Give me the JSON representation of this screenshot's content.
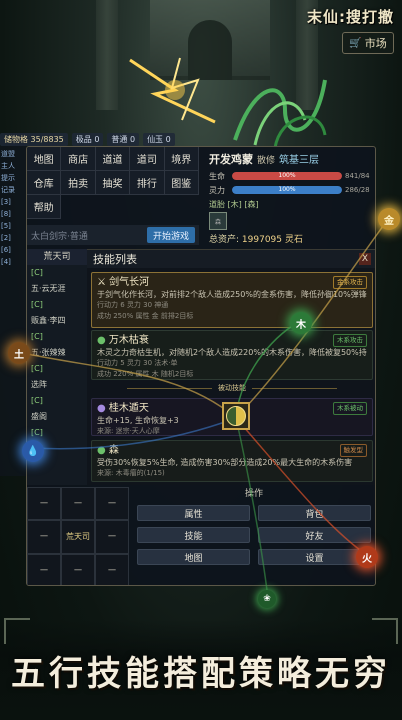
{
  "header": {
    "game_title": "末仙:搜打撤",
    "market_label": "市场",
    "market_icon": "cart-icon"
  },
  "resources": [
    "储物格 35/8835",
    "极品 0",
    "普通 0",
    "仙玉 0"
  ],
  "left_strip": [
    "道盟",
    "主人",
    "提示",
    "记录",
    "[3]",
    "[8]",
    "[5]",
    "[2]",
    "[6]",
    "[4]"
  ],
  "nav": {
    "items": [
      "地图",
      "商店",
      "道道",
      "道司",
      "境界",
      "仓库",
      "拍卖",
      "抽奖",
      "排行",
      "图鉴",
      "帮助"
    ]
  },
  "channel": {
    "placeholder": "太白剑宗·普通",
    "button": "开始游戏"
  },
  "player": {
    "name": "开发鸡蒙",
    "status": "散修",
    "realm": "筑基三层",
    "hp_label": "生命",
    "hp_pct": "100%",
    "hp_val": "841/84",
    "mp_label": "灵力",
    "mp_pct": "100%",
    "mp_val": "286/28",
    "daohao": "道胎 [木] [森]",
    "avatar_label": "森",
    "assets_label": "总资产:",
    "assets_value": "1997095 灵石"
  },
  "sect_list": {
    "header": "荒天司",
    "items": [
      "[C]",
      "五·云无涯",
      "[C]",
      "贩鑫·李四",
      "[C]",
      "五·张辣辣",
      "[C]",
      "选阵",
      "[C]",
      "盛阁",
      "[C]",
      "[C]"
    ]
  },
  "skill_panel": {
    "title": "技能列表",
    "close": "X",
    "passive_divider": "被动技能",
    "skills": [
      {
        "name": "剑气长河",
        "tag": "金系攻击",
        "desc": "于剑气化作长河，对前排2个敌人造成250%的金系伤害，降低孙御10%弹锋6秒",
        "meta": "行动力 6 灵力 30 神通",
        "meta2": "成功 250% 属性 金 前排2目标"
      },
      {
        "name": "万木枯衰",
        "tag": "木系攻击",
        "desc": "木灵之力奇枯生机，对随机2个敌人造成220%的木系伤害，降低被复50%持续10秒",
        "meta": "行动力 5 灵力 30 法术·单",
        "meta2": "成功 220% 属性 木 随机2目标"
      },
      {
        "name": "桂木遁天",
        "tag": "木系被动",
        "desc": "生命+15, 生命恢复+3",
        "meta": "来源: 迷宗·天人心摩"
      },
      {
        "name": "森",
        "tag": "触发型",
        "desc": "受伤30%恢复5%生命, 造成伤害30%部分造成20%最大生命的木系伤害",
        "meta": "来源: 木毒瘤的(1/15)"
      }
    ]
  },
  "bottom_grid": [
    "一",
    "一",
    "一",
    "一",
    "荒天司",
    "一",
    "一",
    "一",
    "一"
  ],
  "operations": {
    "title": "操作",
    "buttons": [
      "属性",
      "背包",
      "技能",
      "好友",
      "地图",
      "设置"
    ]
  },
  "elements": [
    {
      "label": "金",
      "color": "#d6a93c"
    },
    {
      "label": "木",
      "color": "#3c9a4a"
    },
    {
      "label": "土",
      "color": "#a06a2a"
    },
    {
      "label": "水",
      "color": "#3a78c8"
    },
    {
      "label": "火",
      "color": "#d8502a"
    }
  ],
  "slogan": "五行技能搭配策略无穷"
}
